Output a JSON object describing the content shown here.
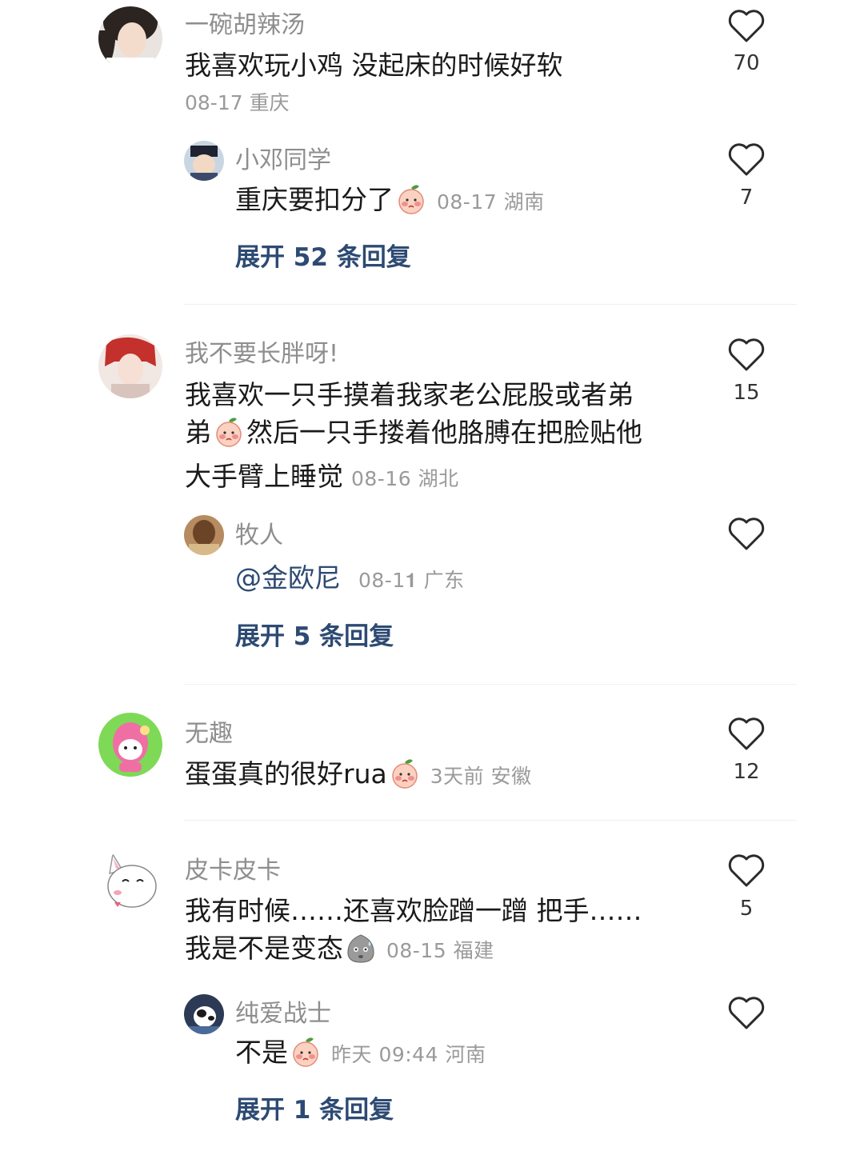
{
  "comments": [
    {
      "username": "一碗胡辣汤",
      "text": "我喜欢玩小鸡 没起床的时候好软",
      "meta": "08-17 重庆",
      "likes": "70",
      "reply": {
        "username": "小邓同学",
        "text": "重庆要扣分了",
        "meta": "08-17 湖南",
        "likes": "7"
      },
      "expand": "展开 52 条回复"
    },
    {
      "username": "我不要长胖呀!",
      "text_line1": "我喜欢一只手摸着我家老公屁股或者弟",
      "text_line2a": "弟",
      "text_line2b": "然后一只手搂着他胳膊在把脸贴他",
      "text_line3": "大手臂上睡觉",
      "meta": "08-16 湖北",
      "likes": "15",
      "reply": {
        "username": "牧人",
        "text": "@金欧尼",
        "meta": "08-1𝟏 广东",
        "likes": ""
      },
      "expand": "展开 5 条回复"
    },
    {
      "username": "无趣",
      "text": "蛋蛋真的很好rua",
      "meta": "3天前 安徽",
      "likes": "12"
    },
    {
      "username": "皮卡皮卡",
      "text_line1": "我有时候……还喜欢脸蹭一蹭 把手……",
      "text_line2": "我是不是变态",
      "meta": "08-15 福建",
      "likes": "5",
      "reply": {
        "username": "纯爱战士",
        "text": "不是",
        "meta": "昨天 09:44 河南",
        "likes": ""
      },
      "expand": "展开 1 条回复"
    }
  ],
  "colors": {
    "username": "#8e8e8e",
    "meta": "#9a9a9a",
    "expand_link": "#2d4a73",
    "text": "#1a1a1a"
  },
  "icons": {
    "like": "heart-outline-icon",
    "emoji_shy": "blushing-peach-emoji",
    "emoji_sad": "grey-sweat-emoji"
  }
}
